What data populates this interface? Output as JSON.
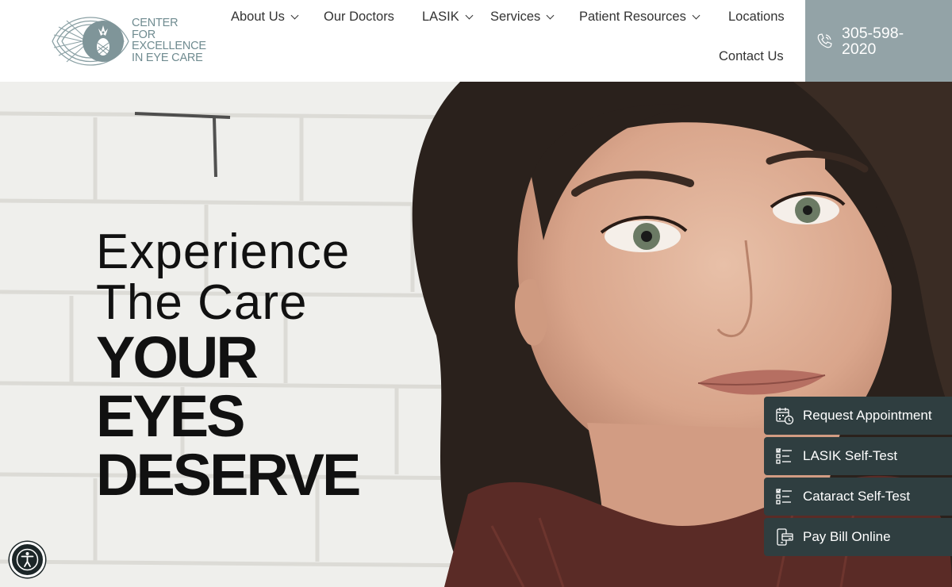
{
  "logo": {
    "lines": [
      "CENTER",
      "FOR",
      "EXCELLENCE",
      "IN EYE CARE"
    ],
    "icon": "pineapple-eye-logo"
  },
  "nav": {
    "about": "About Us",
    "doctors": "Our Doctors",
    "lasik": "LASIK",
    "services": "Services",
    "resources": "Patient Resources",
    "locations": "Locations",
    "contact": "Contact Us"
  },
  "phone": {
    "number": "305-598-2020",
    "icon": "phone-icon"
  },
  "hero": {
    "line1": "Experience",
    "line2": "The Care",
    "line3": "YOUR",
    "line4": "EYES",
    "line5": "DESERVE"
  },
  "cta": {
    "appointment": "Request Appointment",
    "lasik_test": "LASIK Self-Test",
    "cataract_test": "Cataract Self-Test",
    "pay_bill": "Pay Bill Online"
  },
  "colors": {
    "accent": "#93a3a7",
    "logo": "#6f8b90",
    "cta_bg": "#2f3e40"
  }
}
